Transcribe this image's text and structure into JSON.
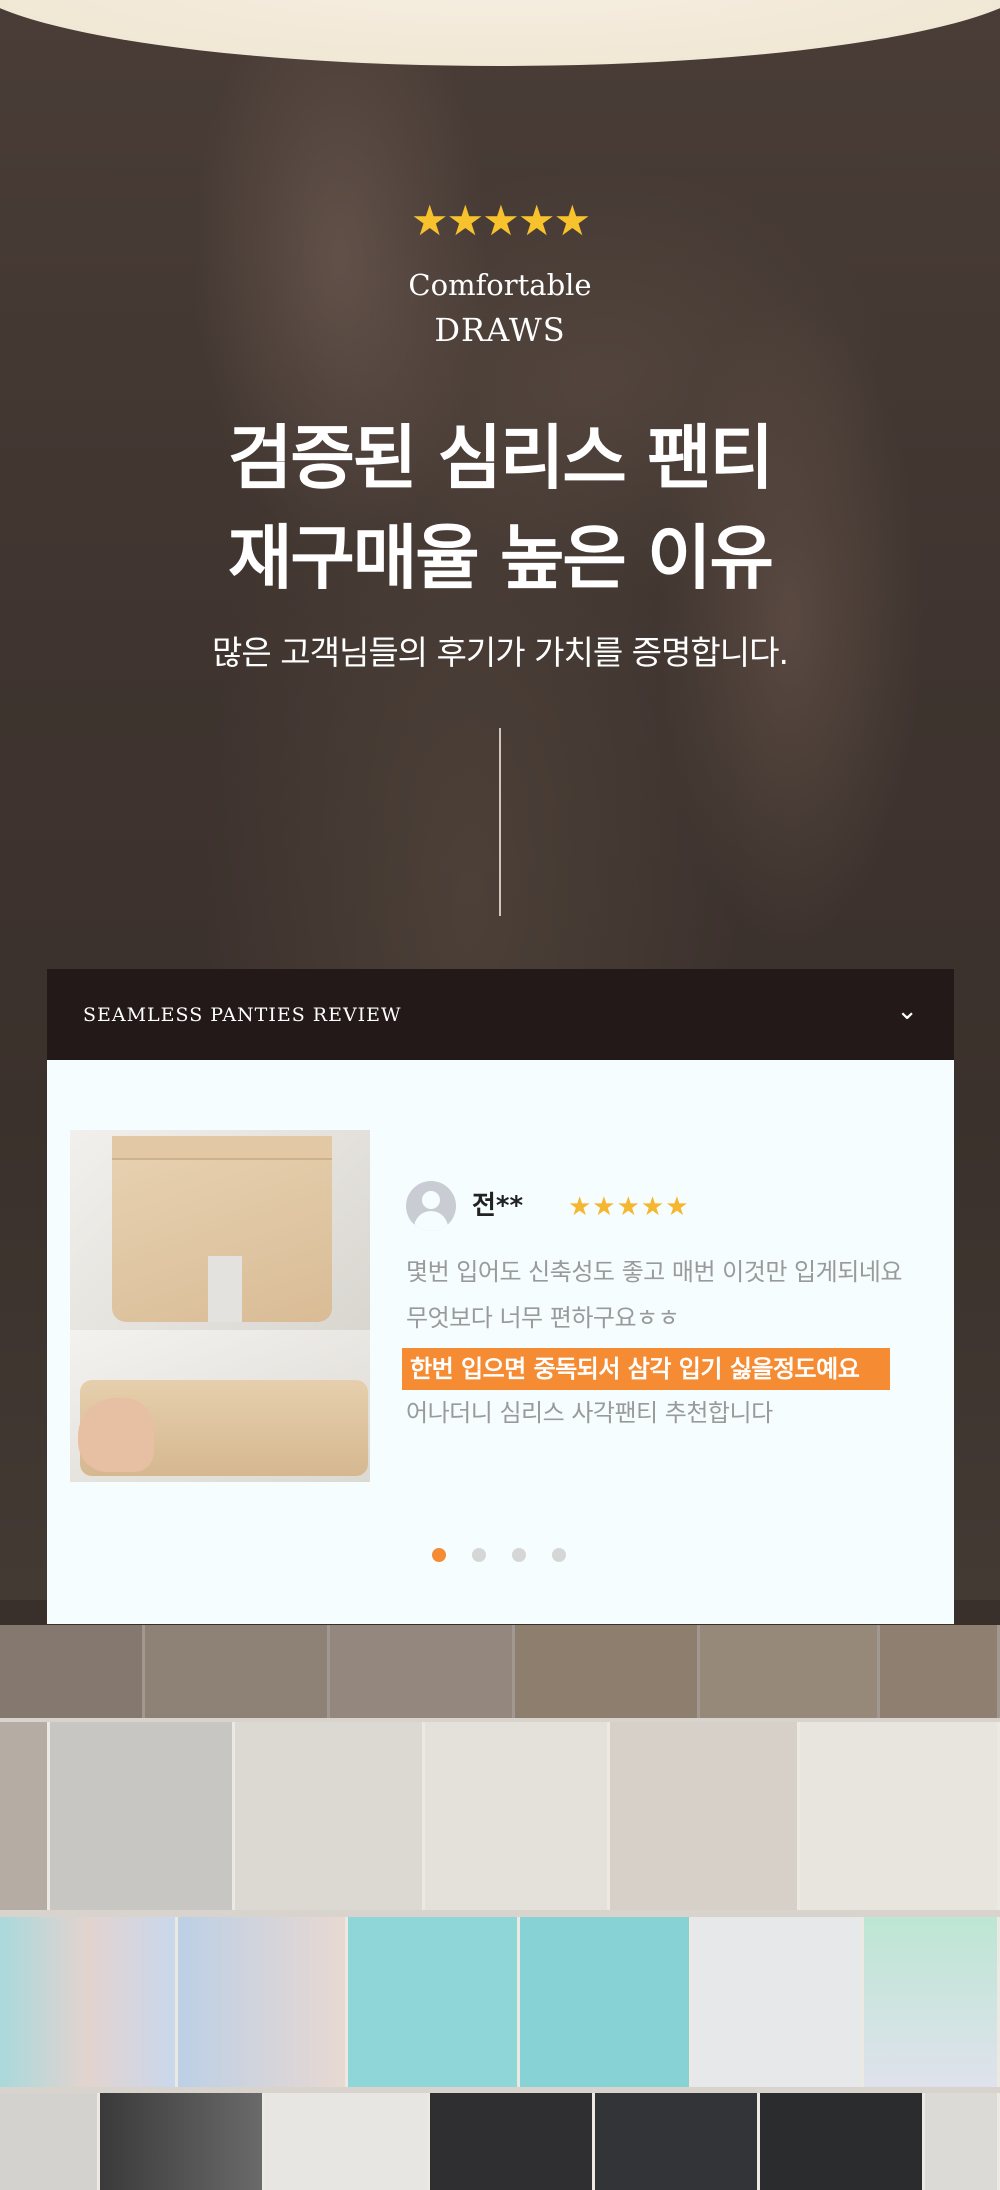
{
  "hero": {
    "stars": "★★★★★",
    "brand_line1": "Comfortable",
    "brand_line2": "DRAWS",
    "headline_line1": "검증된 심리스 팬티",
    "headline_line2": "재구매율 높은 이유",
    "subtitle": "많은 고객님들의 후기가 가치를 증명합니다."
  },
  "review_panel": {
    "header_label": "SEAMLESS PANTIES REVIEW",
    "toggle_icon": "chevron-down-icon",
    "reviewer_name": "전**",
    "rating_stars": "★★★★★",
    "rating": 5,
    "review_lines": [
      "몇번 입어도 신축성도 좋고 매번 이것만 입게되네요",
      "무엇보다 너무 편하구요ㅎㅎ",
      "한번 입으면 중독되서 삼각 입기 싫을정도예요",
      "어나더니 심리스 사각팬티 추천합니다"
    ],
    "highlight_index": 2,
    "slide_count": 4,
    "active_slide": 1
  },
  "colors": {
    "accent_orange": "#f58b33",
    "star_gold": "#f5b630",
    "card_header": "#221918",
    "card_body": "#f5fdff"
  }
}
